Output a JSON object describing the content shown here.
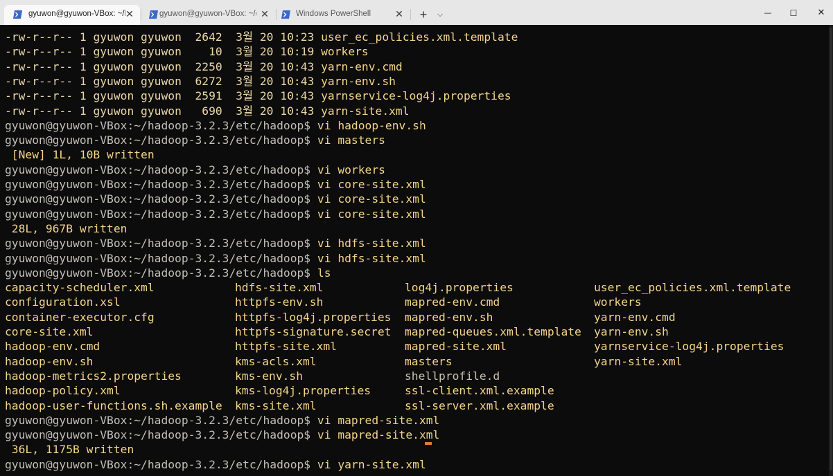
{
  "tabs": [
    {
      "title": "gyuwon@gyuwon-VBox: ~/h",
      "active": true,
      "icon": "powershell-icon",
      "close": "✕"
    },
    {
      "title": "gyuwon@gyuwon-VBox: ~/da",
      "active": false,
      "icon": "powershell-icon",
      "close": "✕"
    },
    {
      "title": "Windows PowerShell",
      "active": false,
      "icon": "powershell-icon",
      "close": "✕"
    }
  ],
  "new_tab_label": "+",
  "dropdown_label": "⌵",
  "window_controls": {
    "minimize": "—",
    "maximize": "☐",
    "close": "✕"
  },
  "colors": {
    "background": "#0c0c0c",
    "tabbar": "#e7e7e7",
    "accent_cursor": "#e37a32",
    "icon_blue": "#3a68c7"
  },
  "terminal": {
    "file_listing": [
      {
        "perm": "-rw-r--r--",
        "links": "1",
        "owner": "gyuwon",
        "group": "gyuwon",
        "size": "2642",
        "month": "3월",
        "day": "20",
        "time": "10:23",
        "name": "user_ec_policies.xml.template"
      },
      {
        "perm": "-rw-r--r--",
        "links": "1",
        "owner": "gyuwon",
        "group": "gyuwon",
        "size": "10",
        "month": "3월",
        "day": "20",
        "time": "10:19",
        "name": "workers"
      },
      {
        "perm": "-rw-r--r--",
        "links": "1",
        "owner": "gyuwon",
        "group": "gyuwon",
        "size": "2250",
        "month": "3월",
        "day": "20",
        "time": "10:43",
        "name": "yarn-env.cmd"
      },
      {
        "perm": "-rw-r--r--",
        "links": "1",
        "owner": "gyuwon",
        "group": "gyuwon",
        "size": "6272",
        "month": "3월",
        "day": "20",
        "time": "10:43",
        "name": "yarn-env.sh"
      },
      {
        "perm": "-rw-r--r--",
        "links": "1",
        "owner": "gyuwon",
        "group": "gyuwon",
        "size": "2591",
        "month": "3월",
        "day": "20",
        "time": "10:43",
        "name": "yarnservice-log4j.properties"
      },
      {
        "perm": "-rw-r--r--",
        "links": "1",
        "owner": "gyuwon",
        "group": "gyuwon",
        "size": "690",
        "month": "3월",
        "day": "20",
        "time": "10:43",
        "name": "yarn-site.xml"
      }
    ],
    "prompt": "gyuwon@gyuwon-VBox:~/hadoop-3.2.3/etc/hadoop$",
    "session_before_ls": [
      {
        "kind": "cmd",
        "text": "vi hadoop-env.sh"
      },
      {
        "kind": "cmd",
        "text": "vi masters"
      },
      {
        "kind": "out",
        "text": " [New] 1L, 10B written"
      },
      {
        "kind": "cmd",
        "text": "vi workers"
      },
      {
        "kind": "cmd",
        "text": "vi core-site.xml"
      },
      {
        "kind": "cmd",
        "text": "vi core-site.xml"
      },
      {
        "kind": "cmd",
        "text": "vi core-site.xml"
      },
      {
        "kind": "out",
        "text": " 28L, 967B written"
      },
      {
        "kind": "cmd",
        "text": "vi hdfs-site.xml"
      },
      {
        "kind": "cmd",
        "text": "vi hdfs-site.xml"
      },
      {
        "kind": "cmd",
        "text": "ls"
      }
    ],
    "ls_columns": [
      [
        "capacity-scheduler.xml",
        "configuration.xsl",
        "container-executor.cfg",
        "core-site.xml",
        "hadoop-env.cmd",
        "hadoop-env.sh",
        "hadoop-metrics2.properties",
        "hadoop-policy.xml",
        "hadoop-user-functions.sh.example"
      ],
      [
        "hdfs-site.xml",
        "httpfs-env.sh",
        "httpfs-log4j.properties",
        "httpfs-signature.secret",
        "httpfs-site.xml",
        "kms-acls.xml",
        "kms-env.sh",
        "kms-log4j.properties",
        "kms-site.xml"
      ],
      [
        "log4j.properties",
        "mapred-env.cmd",
        "mapred-env.sh",
        "mapred-queues.xml.template",
        "mapred-site.xml",
        "masters",
        "shellprofile.d",
        "ssl-client.xml.example",
        "ssl-server.xml.example"
      ],
      [
        "user_ec_policies.xml.template",
        "workers",
        "yarn-env.cmd",
        "yarn-env.sh",
        "yarnservice-log4j.properties",
        "yarn-site.xml"
      ]
    ],
    "ls_directories": [
      "shellprofile.d"
    ],
    "session_after_ls": [
      {
        "kind": "cmd",
        "text": "vi mapred-site.xml"
      },
      {
        "kind": "cmd",
        "text": "vi mapred-site.xml"
      },
      {
        "kind": "out",
        "text": " 36L, 1175B written"
      },
      {
        "kind": "cmd",
        "text": "vi yarn-site.xml"
      }
    ]
  }
}
